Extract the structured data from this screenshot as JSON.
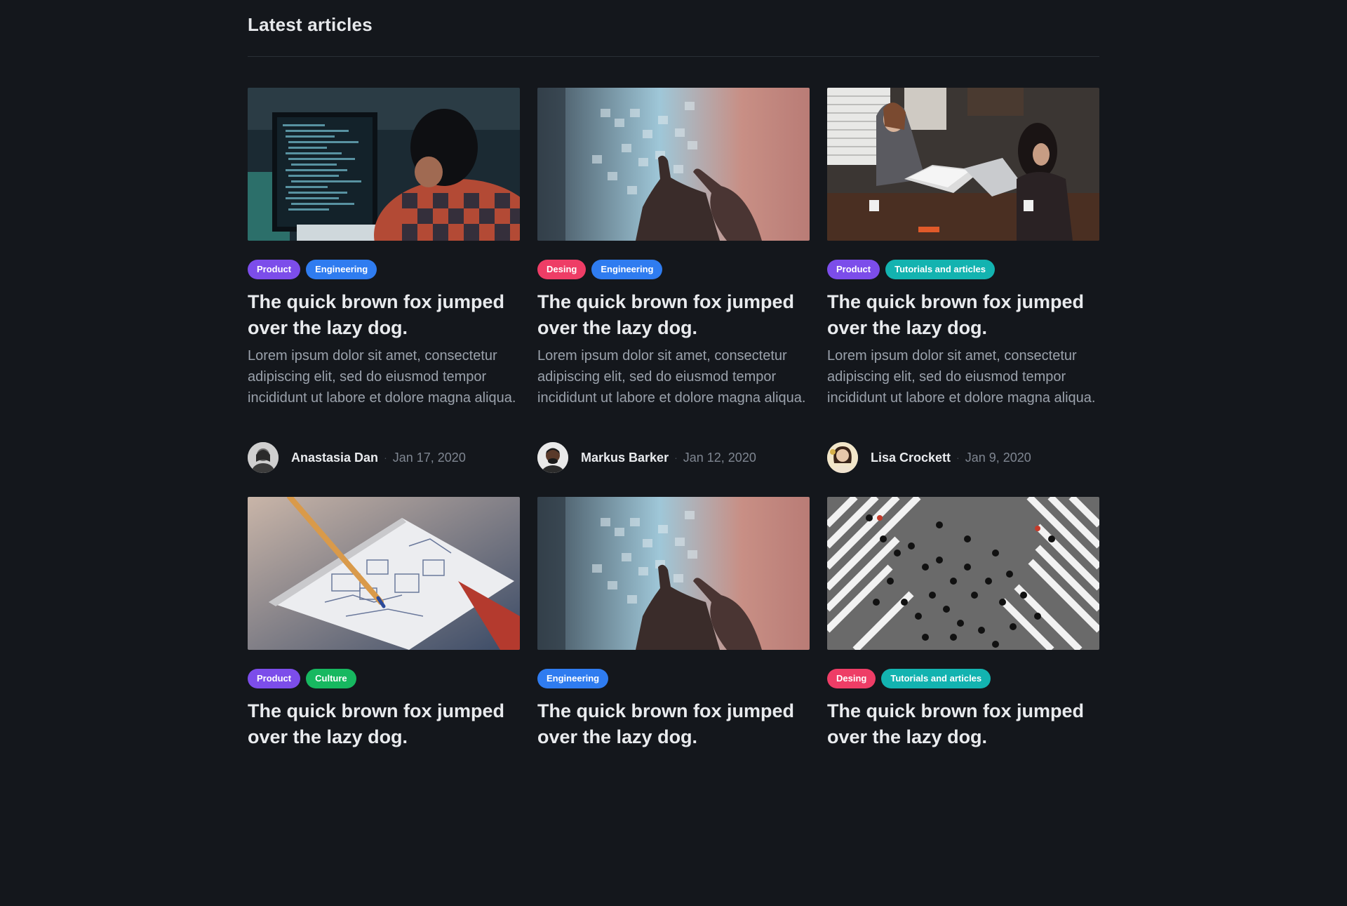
{
  "section": {
    "title": "Latest articles"
  },
  "tag_colors": {
    "Product": "#7c4dea",
    "Engineering": "#2f7cf0",
    "Desing": "#ee3d66",
    "Tutorials and articles": "#13b3b0",
    "Culture": "#17b860"
  },
  "articles": [
    {
      "image": "programmer-at-code-screen",
      "tags": [
        "Product",
        "Engineering"
      ],
      "title": "The quick brown fox jumped over the lazy dog.",
      "excerpt": "Lorem ipsum dolor sit amet, consectetur adipiscing elit, sed do eiusmod tempor incididunt ut labore et dolore magna aliqua.",
      "author": "Anastasia Dan",
      "date": "Jan 17, 2020"
    },
    {
      "image": "sticky-notes-wall",
      "tags": [
        "Desing",
        "Engineering"
      ],
      "title": "The quick brown fox jumped over the lazy dog.",
      "excerpt": "Lorem ipsum dolor sit amet, consectetur adipiscing elit, sed do eiusmod tempor incididunt ut labore et dolore magna aliqua.",
      "author": "Markus Barker",
      "date": "Jan 12, 2020"
    },
    {
      "image": "women-at-laptops",
      "tags": [
        "Product",
        "Tutorials and articles"
      ],
      "title": "The quick brown fox jumped over the lazy dog.",
      "excerpt": "Lorem ipsum dolor sit amet, consectetur adipiscing elit, sed do eiusmod tempor incididunt ut labore et dolore magna aliqua.",
      "author": "Lisa Crockett",
      "date": "Jan 9, 2020"
    },
    {
      "image": "sketch-notebook-pencil",
      "tags": [
        "Product",
        "Culture"
      ],
      "title": "The quick brown fox jumped over the lazy dog."
    },
    {
      "image": "sticky-notes-wall",
      "tags": [
        "Engineering"
      ],
      "title": "The quick brown fox jumped over the lazy dog."
    },
    {
      "image": "crosswalk-crowd-aerial",
      "tags": [
        "Desing",
        "Tutorials and articles"
      ],
      "title": "The quick brown fox jumped over the lazy dog."
    }
  ]
}
